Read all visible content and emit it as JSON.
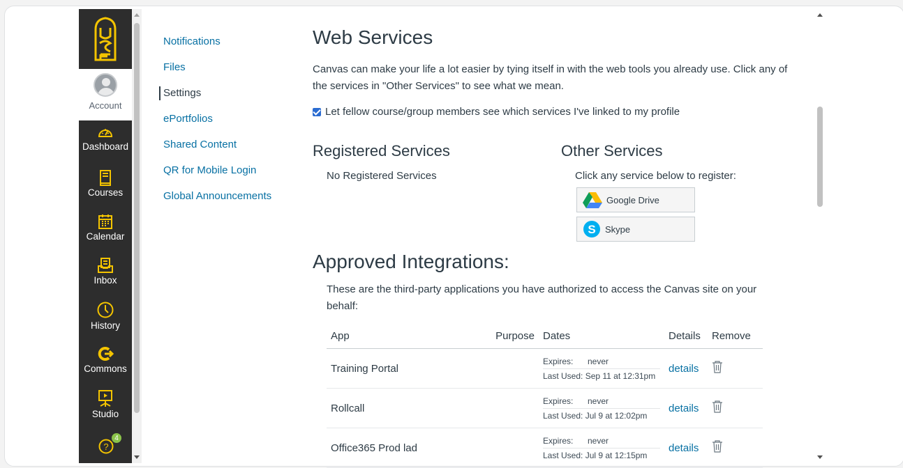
{
  "global_nav": {
    "account": "Account",
    "items": [
      {
        "label": "Dashboard",
        "icon": "dashboard-icon"
      },
      {
        "label": "Courses",
        "icon": "courses-icon"
      },
      {
        "label": "Calendar",
        "icon": "calendar-icon"
      },
      {
        "label": "Inbox",
        "icon": "inbox-icon"
      },
      {
        "label": "History",
        "icon": "history-icon"
      },
      {
        "label": "Commons",
        "icon": "commons-icon"
      },
      {
        "label": "Studio",
        "icon": "studio-icon"
      }
    ],
    "help_badge": "4",
    "accent": "#f4c400"
  },
  "section_nav": {
    "items": [
      "Notifications",
      "Files",
      "Settings",
      "ePortfolios",
      "Shared Content",
      "QR for Mobile Login",
      "Global Announcements"
    ],
    "active": "Settings"
  },
  "web_services": {
    "title": "Web Services",
    "intro": "Canvas can make your life a lot easier by tying itself in with the web tools you already use. Click any of the services in \"Other Services\" to see what we mean.",
    "checkbox_label": "Let fellow course/group members see which services I've linked to my profile",
    "checkbox_checked": true,
    "registered_title": "Registered Services",
    "registered_empty": "No Registered Services",
    "other_title": "Other Services",
    "other_hint": "Click any service below to register:",
    "services": [
      "Google Drive",
      "Skype"
    ]
  },
  "approved": {
    "title": "Approved Integrations:",
    "desc": "These are the third-party applications you have authorized to access the Canvas site on your behalf:",
    "columns": [
      "App",
      "Purpose",
      "Dates",
      "Details",
      "Remove"
    ],
    "rows": [
      {
        "app": "Training Portal",
        "purpose": "",
        "expires_label": "Expires:",
        "expires": "never",
        "last_used": "Last Used: Sep 11 at 12:31pm",
        "details": "details"
      },
      {
        "app": "Rollcall",
        "purpose": "",
        "expires_label": "Expires:",
        "expires": "never",
        "last_used": "Last Used: Jul 9 at 12:02pm",
        "details": "details"
      },
      {
        "app": "Office365 Prod lad",
        "purpose": "",
        "expires_label": "Expires:",
        "expires": "never",
        "last_used": "Last Used: Jul 9 at 12:15pm",
        "details": "details"
      }
    ]
  }
}
